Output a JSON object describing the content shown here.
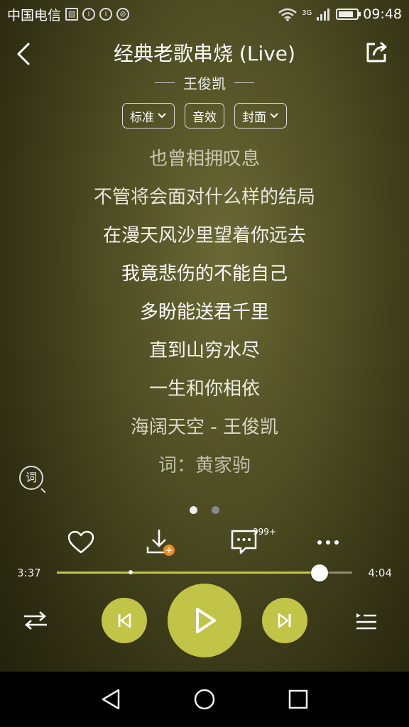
{
  "status": {
    "carrier": "中国电信",
    "network": "3G",
    "time": "09:48",
    "battery_level": 0.7
  },
  "header": {
    "title": "经典老歌串烧 (Live)",
    "artist": "王俊凯"
  },
  "chips": {
    "quality": "标准",
    "effect": "音效",
    "cover": "封面"
  },
  "lyrics": [
    {
      "text": "也曾相拥叹息",
      "color": "#c7c7b2"
    },
    {
      "text": "不管将会面对什么样的结局",
      "color": "#e6e6dc"
    },
    {
      "text": "在漫天风沙里望着你远去",
      "color": "#f0f0ea"
    },
    {
      "text": "我竟悲伤的不能自己",
      "color": "#ffffff"
    },
    {
      "text": "多盼能送君千里",
      "color": "#ffffff"
    },
    {
      "text": "直到山穷水尽",
      "color": "#f5f5ee"
    },
    {
      "text": "一生和你相依",
      "color": "#ececdf"
    },
    {
      "text": "海阔天空 - 王俊凯",
      "color": "#d8d8c6"
    },
    {
      "text": "词：黄家驹",
      "color": "#c0c0aa"
    }
  ],
  "lyric_toggle_label": "词",
  "comments_badge": "999+",
  "progress": {
    "current": "3:37",
    "total": "4:04",
    "played_fraction": 0.889,
    "buffered_marker_fraction": 0.25
  },
  "page_indicator": {
    "count": 2,
    "active": 0
  },
  "colors": {
    "accent": "#c2c448"
  }
}
